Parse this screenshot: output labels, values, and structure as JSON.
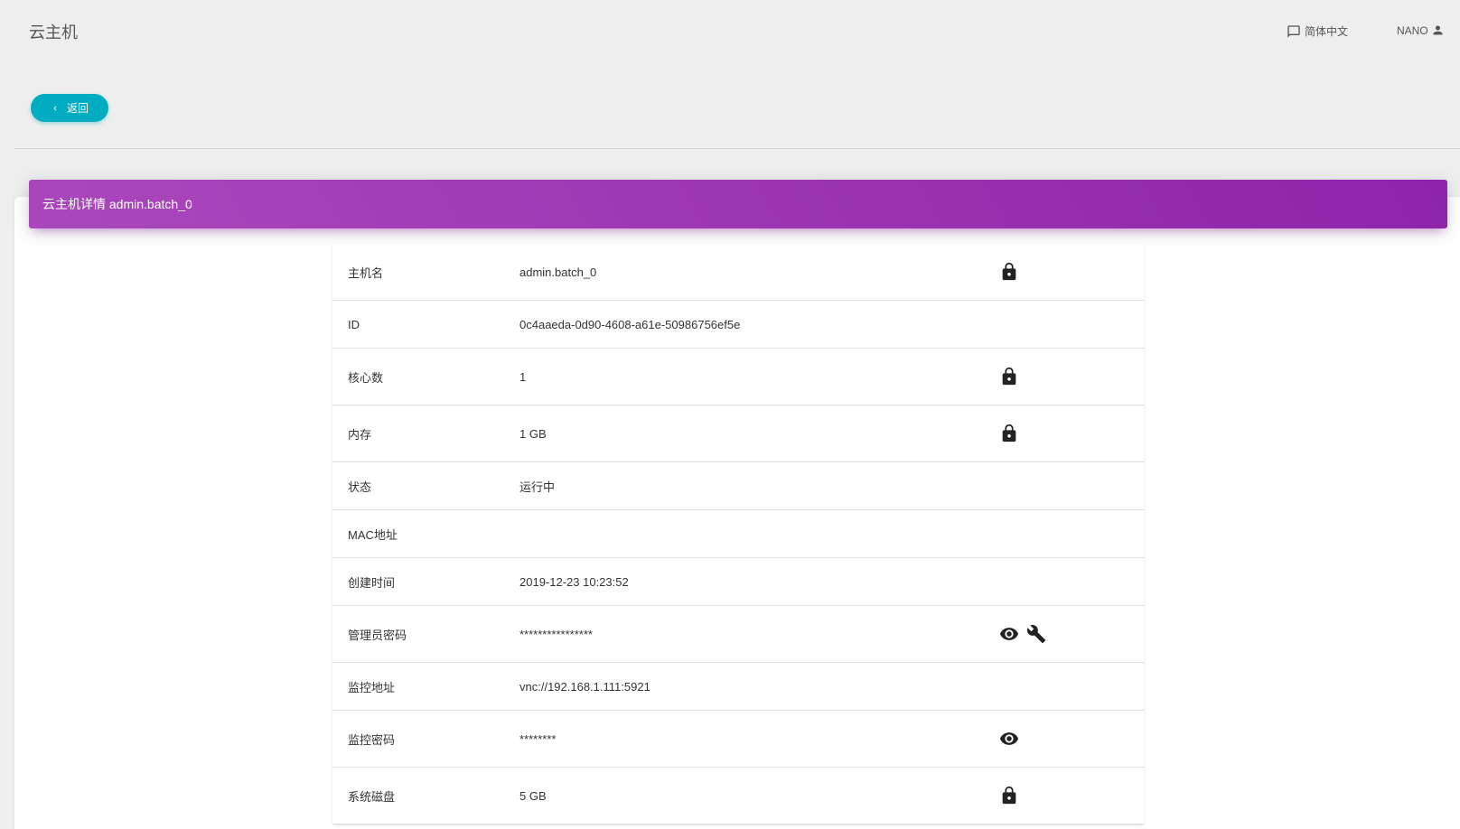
{
  "header": {
    "title": "云主机",
    "language_label": "简体中文",
    "user_label": "NANO"
  },
  "back_button": {
    "label": "返回"
  },
  "card": {
    "title": "云主机详情 admin.batch_0"
  },
  "details": [
    {
      "label": "主机名",
      "value": "admin.batch_0",
      "icons": [
        "lock-icon"
      ]
    },
    {
      "label": "ID",
      "value": "0c4aaeda-0d90-4608-a61e-50986756ef5e",
      "icons": []
    },
    {
      "label": "核心数",
      "value": "1",
      "icons": [
        "lock-icon"
      ]
    },
    {
      "label": "内存",
      "value": "1 GB",
      "icons": [
        "lock-icon"
      ]
    },
    {
      "label": "状态",
      "value": "运行中",
      "icons": []
    },
    {
      "label": "MAC地址",
      "value": "",
      "icons": []
    },
    {
      "label": "创建时间",
      "value": "2019-12-23 10:23:52",
      "icons": []
    },
    {
      "label": "管理员密码",
      "value": "****************",
      "icons": [
        "eye-icon",
        "wrench-icon"
      ]
    },
    {
      "label": "监控地址",
      "value": "vnc://192.168.1.111:5921",
      "icons": []
    },
    {
      "label": "监控密码",
      "value": "********",
      "icons": [
        "eye-icon"
      ]
    },
    {
      "label": "系统磁盘",
      "value": "5 GB",
      "icons": [
        "lock-icon"
      ]
    }
  ],
  "colors": {
    "accent": "#00acc1",
    "header_gradient_start": "#ab47bc",
    "header_gradient_end": "#8e24aa",
    "background": "#eeeeee"
  }
}
